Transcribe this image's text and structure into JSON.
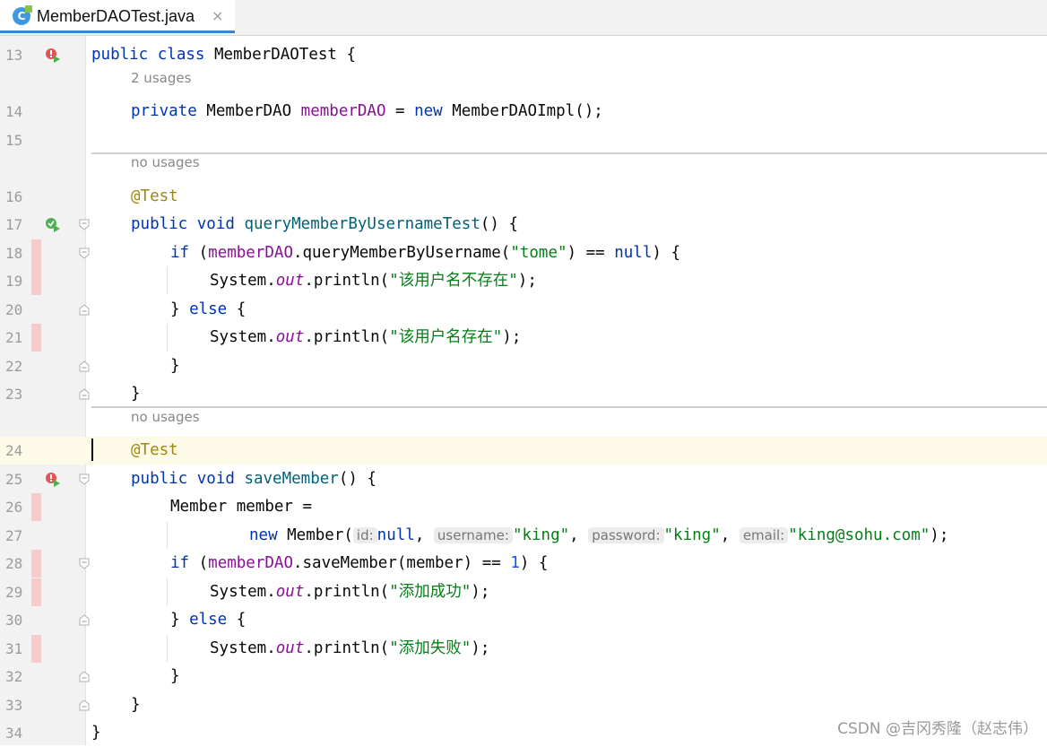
{
  "tab": {
    "icon_letter": "C",
    "filename": "MemberDAOTest.java",
    "close": "×"
  },
  "lines": {
    "l13": {
      "num": "13",
      "kw": "public class",
      "name": " MemberDAOTest {"
    },
    "h1": "2 usages",
    "l14": {
      "num": "14",
      "kw": "private",
      "type": " MemberDAO ",
      "field": "memberDAO",
      "eq": " = ",
      "new": "new",
      "rest": " MemberDAOImpl();"
    },
    "l15": {
      "num": "15"
    },
    "h2": "no usages",
    "l16": {
      "num": "16",
      "ann": "@Test"
    },
    "l17": {
      "num": "17",
      "kw": "public void",
      "method": "queryMemberByUsernameTest",
      "rest": "() {"
    },
    "l18": {
      "num": "18",
      "kw": "if",
      "open": " (",
      "field": "memberDAO",
      "call": ".queryMemberByUsername(",
      "str": "\"tome\"",
      "cmp": ") == ",
      "nul": "null",
      "rest": ") {"
    },
    "l19": {
      "num": "19",
      "sys": "System.",
      "out": "out",
      "call": ".println(",
      "str": "\"该用户名不存在\"",
      "rest": ");"
    },
    "l20": {
      "num": "20",
      "brace": "} ",
      "kw": "else",
      "rest": " {"
    },
    "l21": {
      "num": "21",
      "sys": "System.",
      "out": "out",
      "call": ".println(",
      "str": "\"该用户名存在\"",
      "rest": ");"
    },
    "l22": {
      "num": "22",
      "text": "}"
    },
    "l23": {
      "num": "23",
      "text": "}"
    },
    "h3": "no usages",
    "l24": {
      "num": "24",
      "ann": "@Test"
    },
    "l25": {
      "num": "25",
      "kw": "public void",
      "method": "saveMember",
      "rest": "() {"
    },
    "l26": {
      "num": "26",
      "text": "Member member ="
    },
    "l27": {
      "num": "27",
      "new": "new",
      "ctor": " Member(",
      "h_id": "id:",
      "nul": "null",
      "c1": ", ",
      "h_user": "username:",
      "s1": "\"king\"",
      "c2": ", ",
      "h_pass": "password:",
      "s2": "\"king\"",
      "c3": ", ",
      "h_email": "email:",
      "s3": "\"king@sohu.com\"",
      "end": ");"
    },
    "l28": {
      "num": "28",
      "kw": "if",
      "open": " (",
      "field": "memberDAO",
      "call": ".saveMember(member) == ",
      "one": "1",
      "rest": ") {"
    },
    "l29": {
      "num": "29",
      "sys": "System.",
      "out": "out",
      "call": ".println(",
      "str": "\"添加成功\"",
      "rest": ");"
    },
    "l30": {
      "num": "30",
      "brace": "} ",
      "kw": "else",
      "rest": " {"
    },
    "l31": {
      "num": "31",
      "sys": "System.",
      "out": "out",
      "call": ".println(",
      "str": "\"添加失败\"",
      "rest": ");"
    },
    "l32": {
      "num": "32",
      "text": "}"
    },
    "l33": {
      "num": "33",
      "text": "}"
    },
    "l34": {
      "num": "34",
      "text": "}"
    }
  },
  "watermark": "CSDN @吉冈秀隆（赵志伟）",
  "colors": {
    "keyword": "#0033b3",
    "field": "#871094",
    "string": "#067d17",
    "annotation": "#9e880d",
    "method": "#00627a",
    "number": "#1750eb",
    "coverage": "#f8caca",
    "current_line": "#fdfbe8"
  }
}
